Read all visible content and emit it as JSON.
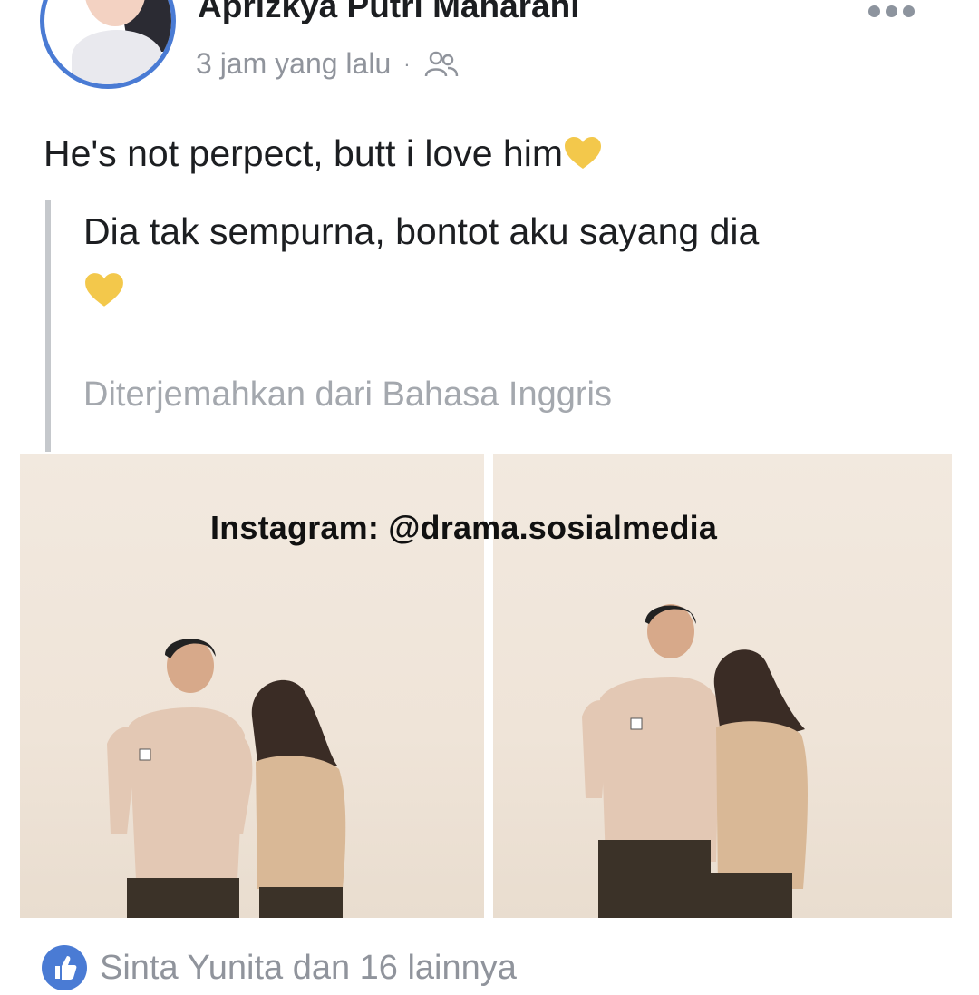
{
  "post": {
    "author_name": "Aprizkya Putri Maharani",
    "timestamp": "3 jam yang lalu",
    "separator": "·",
    "audience_icon": "friends-icon",
    "text": "He's not perpect, butt i love him",
    "text_emoji": "yellow-heart-icon"
  },
  "translation": {
    "text": "Dia tak sempurna, bontot aku sayang dia",
    "source_note": "Diterjemahkan dari Bahasa Inggris"
  },
  "watermark": {
    "text": "Instagram: @drama.sosialmedia"
  },
  "footer": {
    "reactions_text": "Sinta Yunita dan 16 lainnya",
    "reaction_icon": "like-icon"
  },
  "colors": {
    "accent": "#4a7bd4",
    "meta_text": "#90949c",
    "heart": "#f3c84b"
  }
}
